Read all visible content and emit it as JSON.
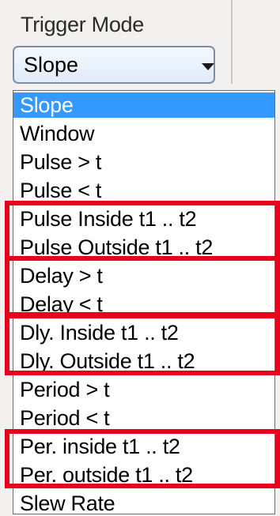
{
  "trigger_mode": {
    "label": "Trigger Mode",
    "selected": "Slope",
    "options": [
      "Slope",
      "Window",
      "Pulse > t",
      "Pulse < t",
      "Pulse Inside t1 .. t2",
      "Pulse Outside t1 .. t2",
      "Delay > t",
      "Delay < t",
      "Dly. Inside t1 .. t2",
      "Dly. Outside t1 .. t2",
      "Period > t",
      "Period < t",
      "Per. inside t1 .. t2",
      "Per. outside t1 .. t2",
      "Slew Rate"
    ]
  },
  "highlight_color": "#e8001c",
  "selection_color": "#3399ff"
}
